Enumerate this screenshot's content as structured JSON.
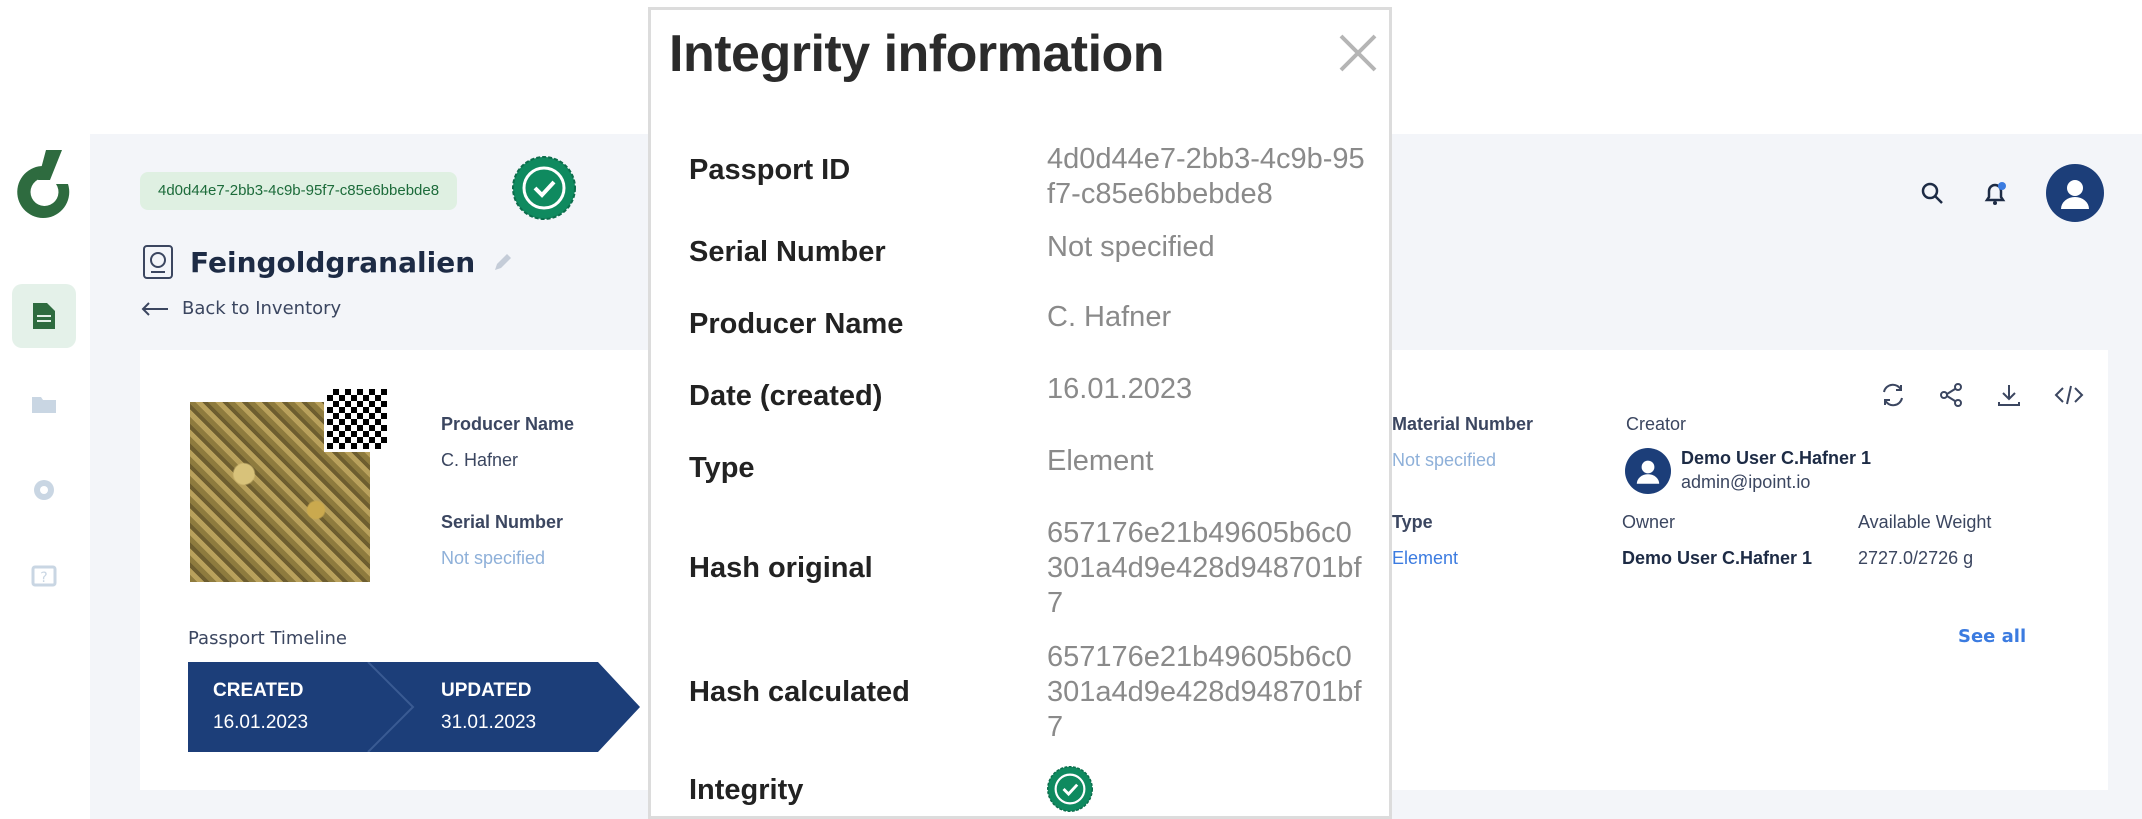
{
  "passport": {
    "id_chip": "4d0d44e7-2bb3-4c9b-95f7-c85e6bbebde8",
    "title": "Feingoldgranalien",
    "back_label": "Back to Inventory"
  },
  "fields": {
    "producer_name_label": "Producer Name",
    "producer_name_value": "C. Hafner",
    "serial_number_label": "Serial Number",
    "serial_number_value": "Not specified",
    "material_number_label": "Material Number",
    "material_number_value": "Not specified",
    "type_label": "Type",
    "type_value": "Element",
    "creator_label": "Creator",
    "creator_name": "Demo User C.Hafner 1",
    "creator_email": "admin@ipoint.io",
    "owner_label": "Owner",
    "owner_value": "Demo User C.Hafner 1",
    "weight_label": "Available Weight",
    "weight_value": "2727.0/2726 g"
  },
  "timeline": {
    "label": "Passport Timeline",
    "created_label": "CREATED",
    "created_date": "16.01.2023",
    "updated_label": "UPDATED",
    "updated_date": "31.01.2023",
    "see_all": "See all"
  },
  "modal": {
    "title": "Integrity information",
    "rows": [
      {
        "label": "Passport ID",
        "value": "4d0d44e7-2bb3-4c9b-95f7-c85e6bbebde8"
      },
      {
        "label": "Serial Number",
        "value": "Not specified"
      },
      {
        "label": "Producer Name",
        "value": "C. Hafner"
      },
      {
        "label": "Date (created)",
        "value": "16.01.2023"
      },
      {
        "label": "Type",
        "value": "Element"
      },
      {
        "label": "Hash original",
        "value": "657176e21b49605b6c0301a4d9e428d948701bf7"
      },
      {
        "label": "Hash calculated",
        "value": "657176e21b49605b6c0301a4d9e428d948701bf7"
      },
      {
        "label": "Integrity",
        "value": ""
      }
    ]
  },
  "colors": {
    "brand_green": "#2e6b3f",
    "verified_green": "#0f8a5f",
    "timeline_blue": "#1c3e79",
    "link_blue": "#3b7be0"
  },
  "icons": [
    "logo-icon",
    "document-icon",
    "folder-icon",
    "gear-icon",
    "help-icon",
    "verified-icon",
    "passport-icon",
    "edit-icon",
    "back-arrow-icon",
    "search-icon",
    "bell-icon",
    "user-icon",
    "sync-icon",
    "share-icon",
    "download-icon",
    "code-icon",
    "close-icon"
  ]
}
